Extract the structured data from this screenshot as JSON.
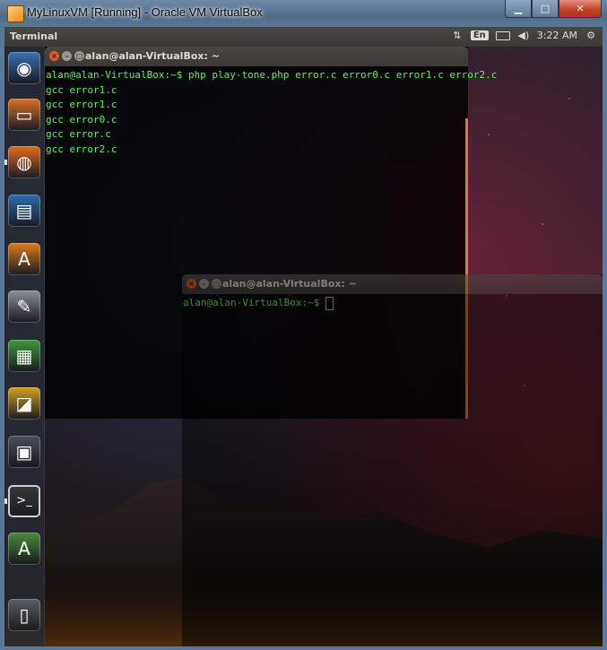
{
  "host_window": {
    "title": "MyLinuxVM [Running] - Oracle VM VirtualBox",
    "buttons": {
      "minimize": "▁",
      "maximize": "□",
      "close": "✕"
    }
  },
  "top_panel": {
    "app_name": "Terminal",
    "keyboard_layout": "En",
    "clock": "3:22 AM",
    "icons": [
      "network-transfer-icon",
      "keyboard-icon",
      "battery-icon",
      "volume-icon",
      "gear-icon"
    ]
  },
  "launcher": {
    "items": [
      {
        "name": "dash-home",
        "glyph": "◉",
        "color": "#3c6fb4"
      },
      {
        "name": "files",
        "glyph": "▭",
        "color": "#d8742a"
      },
      {
        "name": "firefox",
        "glyph": "◍",
        "color": "#e56a1e"
      },
      {
        "name": "libreoffice-writer",
        "glyph": "▤",
        "color": "#2f6db0"
      },
      {
        "name": "software-center",
        "glyph": "A",
        "color": "#e07b1a"
      },
      {
        "name": "system-settings",
        "glyph": "✎",
        "color": "#8a8f96"
      },
      {
        "name": "libreoffice-calc",
        "glyph": "▦",
        "color": "#3f9a3a"
      },
      {
        "name": "libreoffice-impress",
        "glyph": "◪",
        "color": "#d4a020"
      },
      {
        "name": "workspace-switcher",
        "glyph": "▣",
        "color": "#4a4f5a"
      },
      {
        "name": "terminal",
        "glyph": ">_",
        "color": "#3a3a3a"
      },
      {
        "name": "software-updater",
        "glyph": "A",
        "color": "#4d8a3a"
      },
      {
        "name": "trash",
        "glyph": "▯",
        "color": "#5a5e66"
      }
    ]
  },
  "terminal_main": {
    "title": "alan@alan-VirtualBox: ~",
    "lines": [
      "alan@alan-VirtualBox:~$ php play-tone.php error.c error0.c error1.c error2.c",
      "gcc error1.c",
      "gcc error1.c",
      "gcc error0.c",
      "gcc error.c",
      "gcc error2.c"
    ]
  },
  "terminal_background": {
    "title": "alan@alan-VirtualBox: ~",
    "prompt": "alan@alan-VirtualBox:~$ "
  }
}
